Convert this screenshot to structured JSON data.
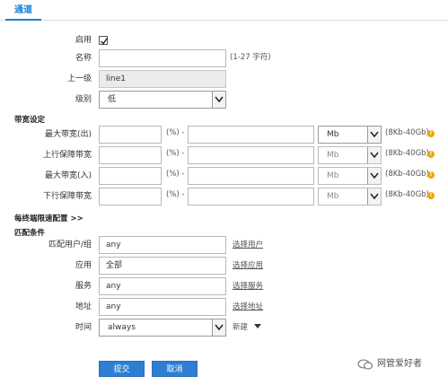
{
  "tabs": [
    {
      "label": "通道"
    }
  ],
  "enable": {
    "label": "启用",
    "checked": true
  },
  "name": {
    "label": "名称",
    "value": "",
    "hint": "(1-27 字符)"
  },
  "parent": {
    "label": "上一级",
    "value": "line1"
  },
  "level": {
    "label": "级别",
    "value": "低"
  },
  "bandwidth": {
    "title": "带宽设定",
    "rows": [
      {
        "label": "最大带宽(出)",
        "percent_suffix": "(%) -",
        "unit": "Mb",
        "range": "(8Kb-40Gb)",
        "disabled": false
      },
      {
        "label": "上行保障带宽",
        "percent_suffix": "(%) -",
        "unit": "Mb",
        "range": "(8Kb-40Gb)",
        "disabled": true
      },
      {
        "label": "最大带宽(入)",
        "percent_suffix": "(%) -",
        "unit": "Mb",
        "range": "(8Kb-40Gb)",
        "disabled": true
      },
      {
        "label": "下行保障带宽",
        "percent_suffix": "(%) -",
        "unit": "Mb",
        "range": "(8Kb-40Gb)",
        "disabled": true
      }
    ]
  },
  "per_endpoint": {
    "label": "每终端限速配置 >>"
  },
  "match": {
    "title": "匹配条件",
    "user": {
      "label": "匹配用户/组",
      "value": "any",
      "link": "选择用户"
    },
    "app": {
      "label": "应用",
      "value": "全部",
      "link": "选择应用"
    },
    "service": {
      "label": "服务",
      "value": "any",
      "link": "选择服务"
    },
    "address": {
      "label": "地址",
      "value": "any",
      "link": "选择地址"
    },
    "time": {
      "label": "时间",
      "value": "always",
      "link": "新建"
    }
  },
  "actions": {
    "submit": "提交",
    "cancel": "取消"
  },
  "watermark": "网管爱好者"
}
